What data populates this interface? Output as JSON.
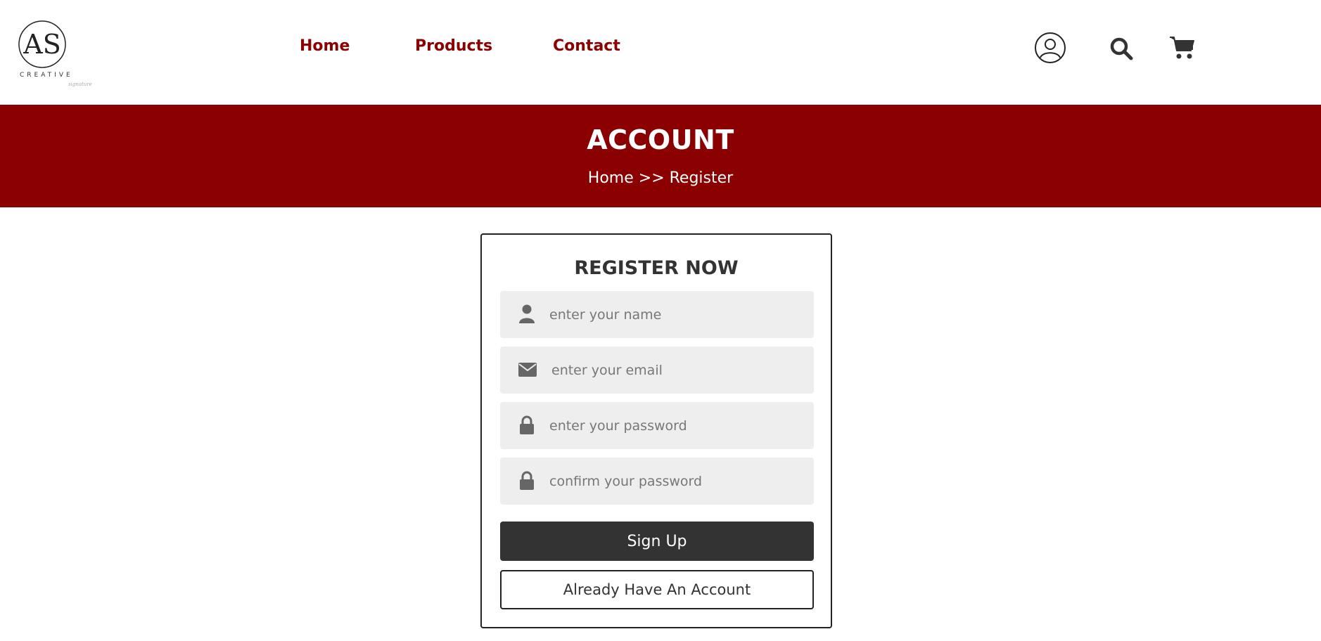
{
  "logo": {
    "monogram": "AS",
    "wordmark": "CREATIVE",
    "signature": "signature"
  },
  "nav": {
    "items": [
      {
        "label": "Home"
      },
      {
        "label": "Products"
      },
      {
        "label": "Contact"
      }
    ]
  },
  "header_icons": [
    "user-circle-icon",
    "search-icon",
    "cart-icon"
  ],
  "banner": {
    "title": "ACCOUNT",
    "breadcrumb": "Home >> Register"
  },
  "form": {
    "title": "REGISTER NOW",
    "fields": [
      {
        "icon": "user-icon",
        "placeholder": "enter your name",
        "value": ""
      },
      {
        "icon": "envelope-icon",
        "placeholder": "enter your email",
        "value": ""
      },
      {
        "icon": "lock-icon",
        "placeholder": "enter your password",
        "value": ""
      },
      {
        "icon": "lock-icon",
        "placeholder": "confirm your password",
        "value": ""
      }
    ],
    "submit_label": "Sign Up",
    "secondary_label": "Already Have An Account"
  },
  "colors": {
    "brand": "#8b0000",
    "dark": "#333333",
    "field_bg": "#eeeeee"
  }
}
